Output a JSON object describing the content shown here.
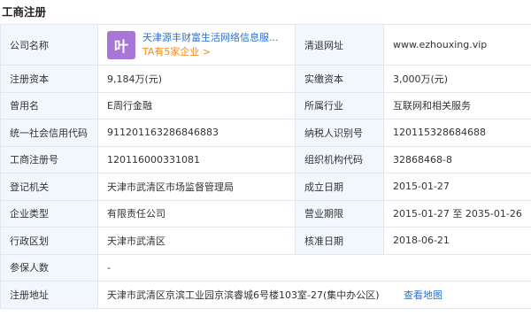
{
  "section": {
    "title": "工商注册"
  },
  "company": {
    "logo_char": "叶",
    "name": "天津源丰财富生活网络信息服...",
    "sub": "TA有5家企业 >"
  },
  "rows": [
    {
      "l1": "公司名称",
      "l3": "清退网址",
      "v3": "www.ezhouxing.vip"
    },
    {
      "l1": "注册资本",
      "v1": "9,184万(元)",
      "l3": "实缴资本",
      "v3": "3,000万(元)"
    },
    {
      "l1": "曾用名",
      "v1": "E周行金融",
      "l3": "所属行业",
      "v3": "互联网和相关服务"
    },
    {
      "l1": "统一社会信用代码",
      "v1": "911201163286846883",
      "l3": "纳税人识别号",
      "v3": "120115328684688"
    },
    {
      "l1": "工商注册号",
      "v1": "120116000331081",
      "l3": "组织机构代码",
      "v3": "32868468-8"
    },
    {
      "l1": "登记机关",
      "v1": "天津市武清区市场监督管理局",
      "l3": "成立日期",
      "v3": "2015-01-27"
    },
    {
      "l1": "企业类型",
      "v1": "有限责任公司",
      "l3": "营业期限",
      "v3": "2015-01-27 至 2035-01-26"
    },
    {
      "l1": "行政区划",
      "v1": "天津市武清区",
      "l3": "核准日期",
      "v3": "2018-06-21"
    },
    {
      "l1": "参保人数",
      "v1": "-"
    },
    {
      "l1": "注册地址",
      "v1": "天津市武清区京滨工业园京滨睿城6号楼103室-27(集中办公区)",
      "link": "查看地图"
    }
  ]
}
